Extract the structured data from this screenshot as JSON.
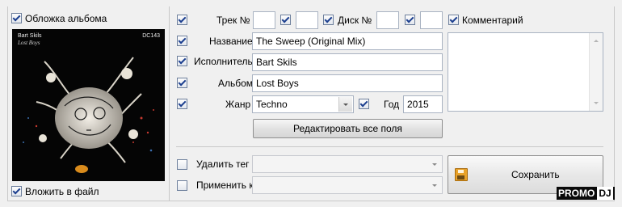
{
  "cover_panel": {
    "cover_label": "Обложка альбома",
    "embed_label": "Вложить в файл",
    "artist_text": "Bart Skils",
    "album_text": "Lost Boys",
    "catalog_text": "DC143"
  },
  "tags": {
    "track_label": "Трек №",
    "track_value": "",
    "track_total_value": "",
    "disc_label": "Диск №",
    "disc_value": "",
    "disc_total_value": "",
    "comment_label": "Комментарий",
    "comment_value": "",
    "title_label": "Название",
    "title_value": "The Sweep (Original Mix)",
    "artist_label": "Исполнитель",
    "artist_value": "Bart Skils",
    "album_label": "Альбом",
    "album_value": "Lost Boys",
    "genre_label": "Жанр",
    "genre_value": "Techno",
    "year_label": "Год",
    "year_value": "2015",
    "edit_all_label": "Редактировать все поля"
  },
  "actions": {
    "delete_tag_label": "Удалить тег",
    "delete_tag_value": "",
    "apply_to_label": "Применить к",
    "apply_to_value": "",
    "save_label": "Сохранить"
  },
  "watermark": {
    "left_text": "PROMO",
    "right_text": "DJ"
  },
  "colors": {
    "checkmark": "#1c3f8f",
    "save_icon": "#e8a22a"
  }
}
